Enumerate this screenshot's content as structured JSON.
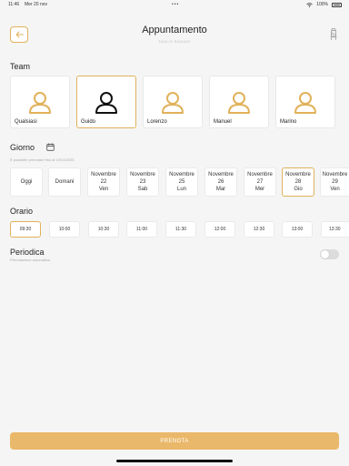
{
  "status_bar": {
    "time": "11:46",
    "date": "Mer 20 nov",
    "dots": "•••",
    "battery": "100%"
  },
  "header": {
    "title": "Appuntamento",
    "subtitle": "TAGLIO RAGAZZ"
  },
  "team": {
    "label": "Team",
    "members": [
      {
        "name": "Qualsiasi",
        "selected": false
      },
      {
        "name": "Guido",
        "selected": true
      },
      {
        "name": "Lorenzo",
        "selected": false
      },
      {
        "name": "Manuel",
        "selected": false
      },
      {
        "name": "Marino",
        "selected": false
      }
    ]
  },
  "giorno": {
    "label": "Giorno",
    "hint": "È possibile prenotare fino al 19/12/2025",
    "days": [
      {
        "line1": "Oggi",
        "line2": "",
        "line3": "",
        "selected": false
      },
      {
        "line1": "Domani",
        "line2": "",
        "line3": "",
        "selected": false
      },
      {
        "line1": "Novembre",
        "line2": "22",
        "line3": "Ven",
        "selected": false
      },
      {
        "line1": "Novembre",
        "line2": "23",
        "line3": "Sab",
        "selected": false
      },
      {
        "line1": "Novembre",
        "line2": "25",
        "line3": "Lun",
        "selected": false
      },
      {
        "line1": "Novembre",
        "line2": "26",
        "line3": "Mar",
        "selected": false
      },
      {
        "line1": "Novembre",
        "line2": "27",
        "line3": "Mer",
        "selected": false
      },
      {
        "line1": "Novembre",
        "line2": "28",
        "line3": "Gio",
        "selected": true
      },
      {
        "line1": "Novembre",
        "line2": "29",
        "line3": "Ven",
        "selected": false
      }
    ]
  },
  "orario": {
    "label": "Orario",
    "times": [
      {
        "value": "09:30",
        "selected": true
      },
      {
        "value": "10:00",
        "selected": false
      },
      {
        "value": "10:30",
        "selected": false
      },
      {
        "value": "11:00",
        "selected": false
      },
      {
        "value": "11:30",
        "selected": false
      },
      {
        "value": "12:00",
        "selected": false
      },
      {
        "value": "12:30",
        "selected": false
      },
      {
        "value": "13:00",
        "selected": false
      },
      {
        "value": "13:30",
        "selected": false
      }
    ]
  },
  "periodica": {
    "label": "Periodica",
    "hint": "Prenotazione automatica",
    "enabled": false
  },
  "cta": {
    "label": "PRENOTA"
  },
  "colors": {
    "accent": "#e1b15a",
    "cta": "#eab86a",
    "background": "#f5f5f5"
  }
}
